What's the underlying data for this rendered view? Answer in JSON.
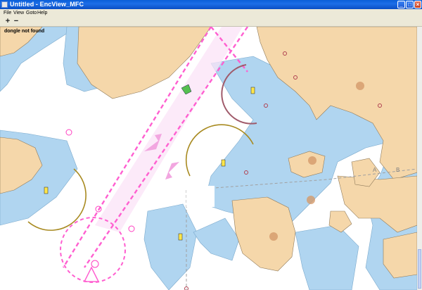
{
  "window": {
    "title": "Untitled - EncView_MFC",
    "minimize_glyph": "_",
    "maximize_glyph": "□",
    "close_glyph": "×"
  },
  "menu": [
    "File",
    "View",
    "Goto",
    "Help"
  ],
  "toolbar": {
    "zoom_in": "+",
    "zoom_out": "−"
  },
  "map": {
    "status_text": "dongle not found",
    "marker_a": "A",
    "marker_b": "B"
  },
  "colors": {
    "land": "#f5d7aa",
    "shallow_water": "#b0d5f0",
    "deep_water": "#ffffff",
    "route": "#ff00ff",
    "titlebar": "#0a5fd8"
  }
}
